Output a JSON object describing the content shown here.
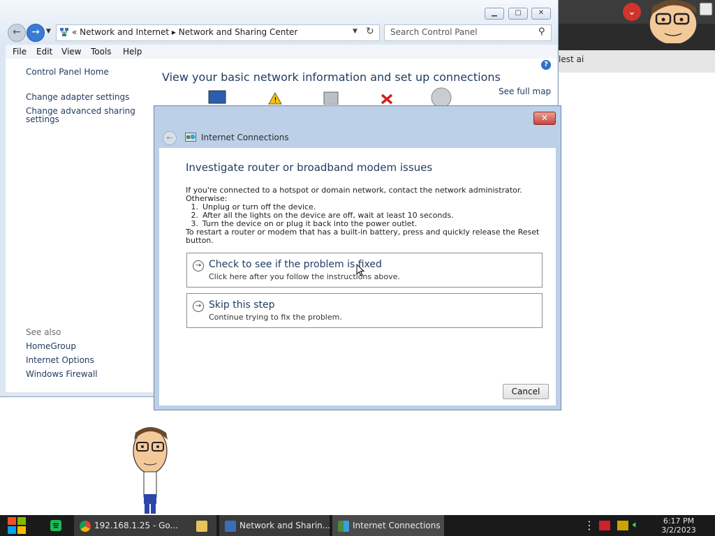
{
  "control_panel": {
    "address": {
      "path": "«  Network and Internet  ▸  Network and Sharing Center"
    },
    "search_placeholder": "Search Control Panel",
    "menu": [
      "File",
      "Edit",
      "View",
      "Tools",
      "Help"
    ],
    "sidebar": {
      "items": [
        "Control Panel Home",
        "Change adapter settings",
        "Change advanced sharing",
        "settings"
      ],
      "see_also_label": "See also",
      "see_also": [
        "HomeGroup",
        "Internet Options",
        "Windows Firewall"
      ]
    },
    "heading": "View your basic network information and set up connections",
    "see_full_map": "See full map"
  },
  "browser_bg": {
    "snippet_text": "lest ai"
  },
  "dialog": {
    "title": "Internet Connections",
    "heading": "Investigate router or broadband modem issues",
    "instructions": {
      "intro": "If you're connected to a hotspot or domain network, contact the network administrator.",
      "otherwise": "Otherwise:",
      "steps": [
        {
          "num": "1.",
          "text": "Unplug or turn off the device."
        },
        {
          "num": "2.",
          "text": "After all the lights on the device are off, wait at least 10 seconds."
        },
        {
          "num": "3.",
          "text": "Turn the device on or plug it back into the power outlet."
        }
      ],
      "reset_line1": "To restart a router or modem that has a built-in battery, press and quickly release the Reset",
      "reset_line2": "button."
    },
    "options": [
      {
        "title": "Check to see if the problem is fixed",
        "subtitle": "Click here after you follow the instructions above."
      },
      {
        "title": "Skip this step",
        "subtitle": "Continue trying to fix the problem."
      }
    ],
    "cancel_label": "Cancel"
  },
  "taskbar": {
    "items": [
      {
        "label": "192.168.1.25 - Go...",
        "icon": "chrome-icon"
      },
      {
        "label": "Network and Sharin...",
        "icon": "network-center-icon"
      },
      {
        "label": "Internet Connections",
        "icon": "internet-connections-icon"
      }
    ],
    "time": "6:17 PM",
    "date": "3/2/2023"
  },
  "colors": {
    "link": "#1e3a5f",
    "taskbar": "#1a1a1a",
    "dialog_frame": "#bcd0e8"
  }
}
